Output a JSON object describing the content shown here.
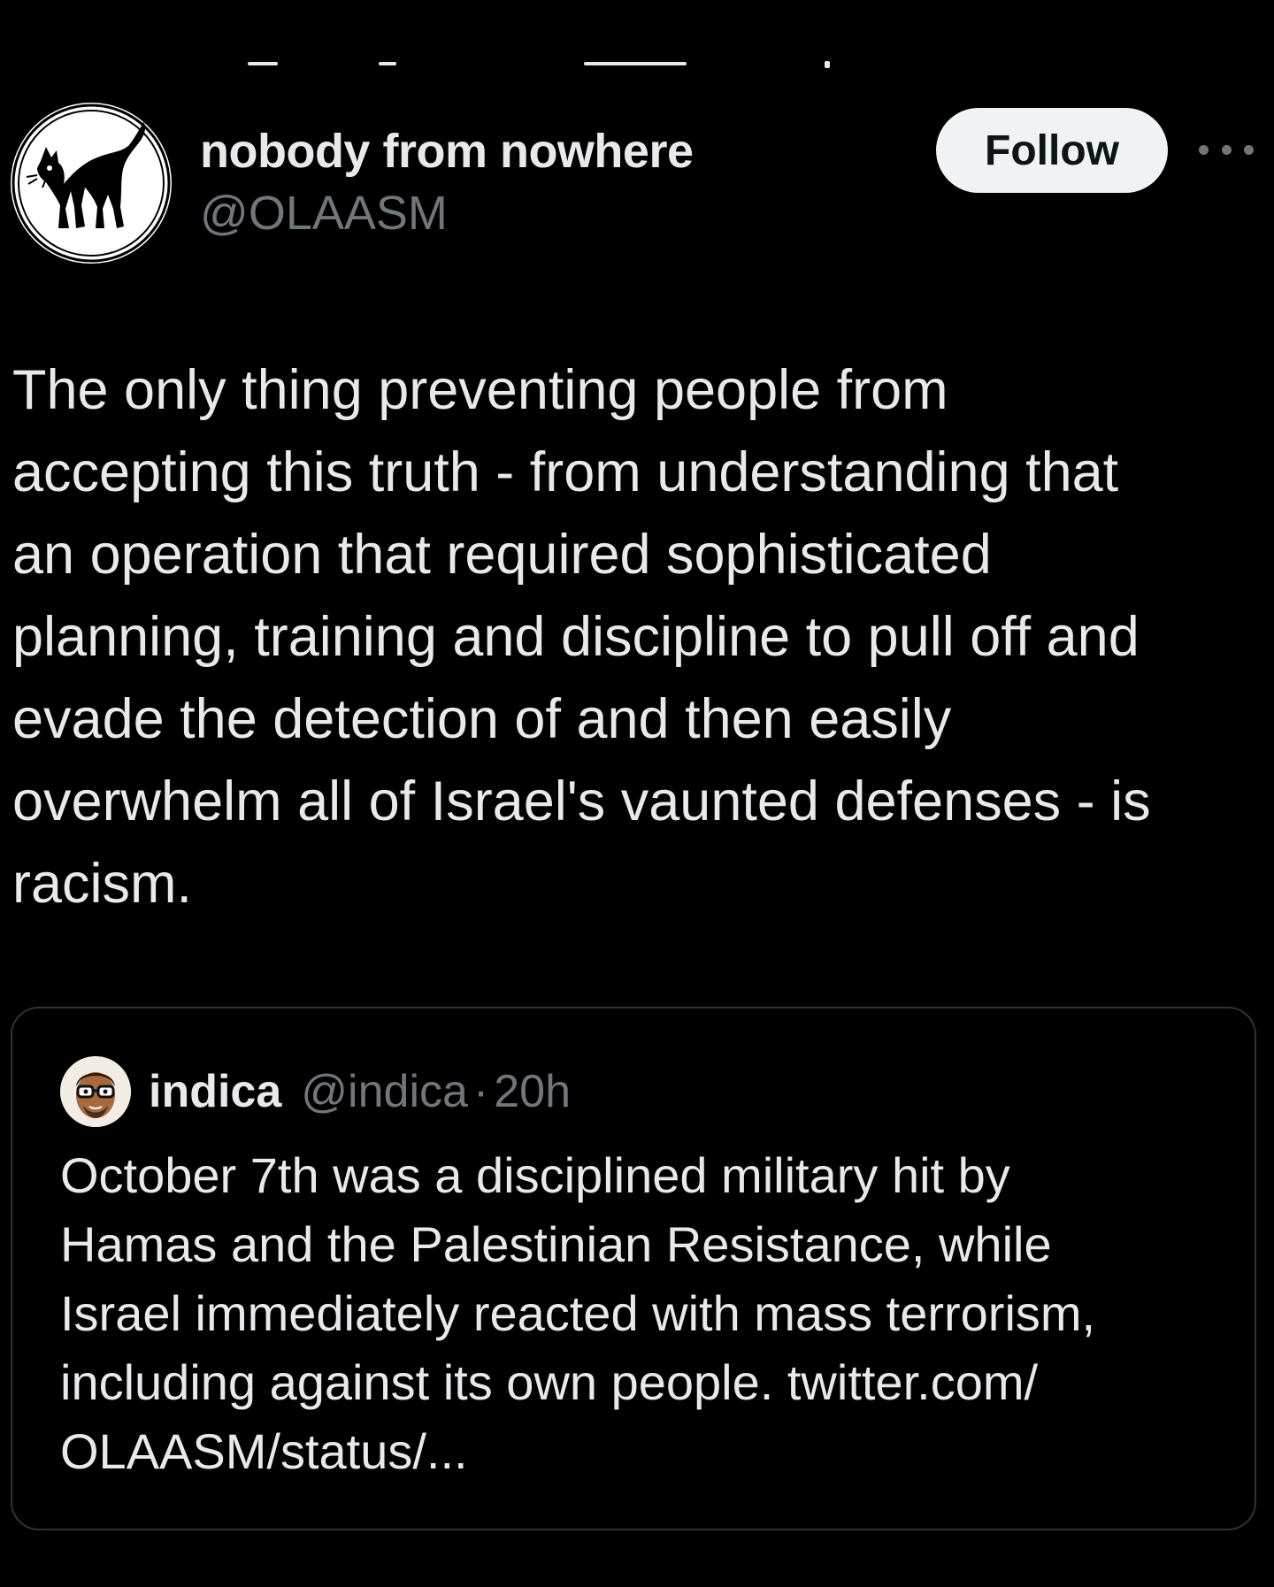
{
  "tweet": {
    "author": {
      "display_name": "nobody from nowhere",
      "handle": "@OLAASM",
      "avatar_icon": "black-cat-icon"
    },
    "follow_label": "Follow",
    "more_icon": "more-options-icon",
    "text_lines": [
      "The only thing preventing people from",
      "accepting this truth - from understanding that",
      "an operation that required sophisticated",
      "planning, training and discipline to pull off and",
      "evade the detection of and then easily",
      "overwhelm all of Israel's vaunted defenses - is",
      "racism."
    ]
  },
  "quote": {
    "author": {
      "display_name": "indica",
      "handle": "@indica",
      "separator": "·",
      "time": "20h",
      "avatar_icon": "cartoon-face-avatar"
    },
    "text_lines": [
      "October 7th was a disciplined military hit by",
      "Hamas and the Palestinian Resistance, while",
      "Israel immediately reacted with mass terrorism,",
      "including against its own people. twitter.com/",
      "OLAASM/status/..."
    ]
  },
  "colors": {
    "background": "#000000",
    "primary_text": "#e7e9ea",
    "secondary_text": "#71767b",
    "follow_button_bg": "#eff3f4",
    "border": "#2f3336"
  }
}
